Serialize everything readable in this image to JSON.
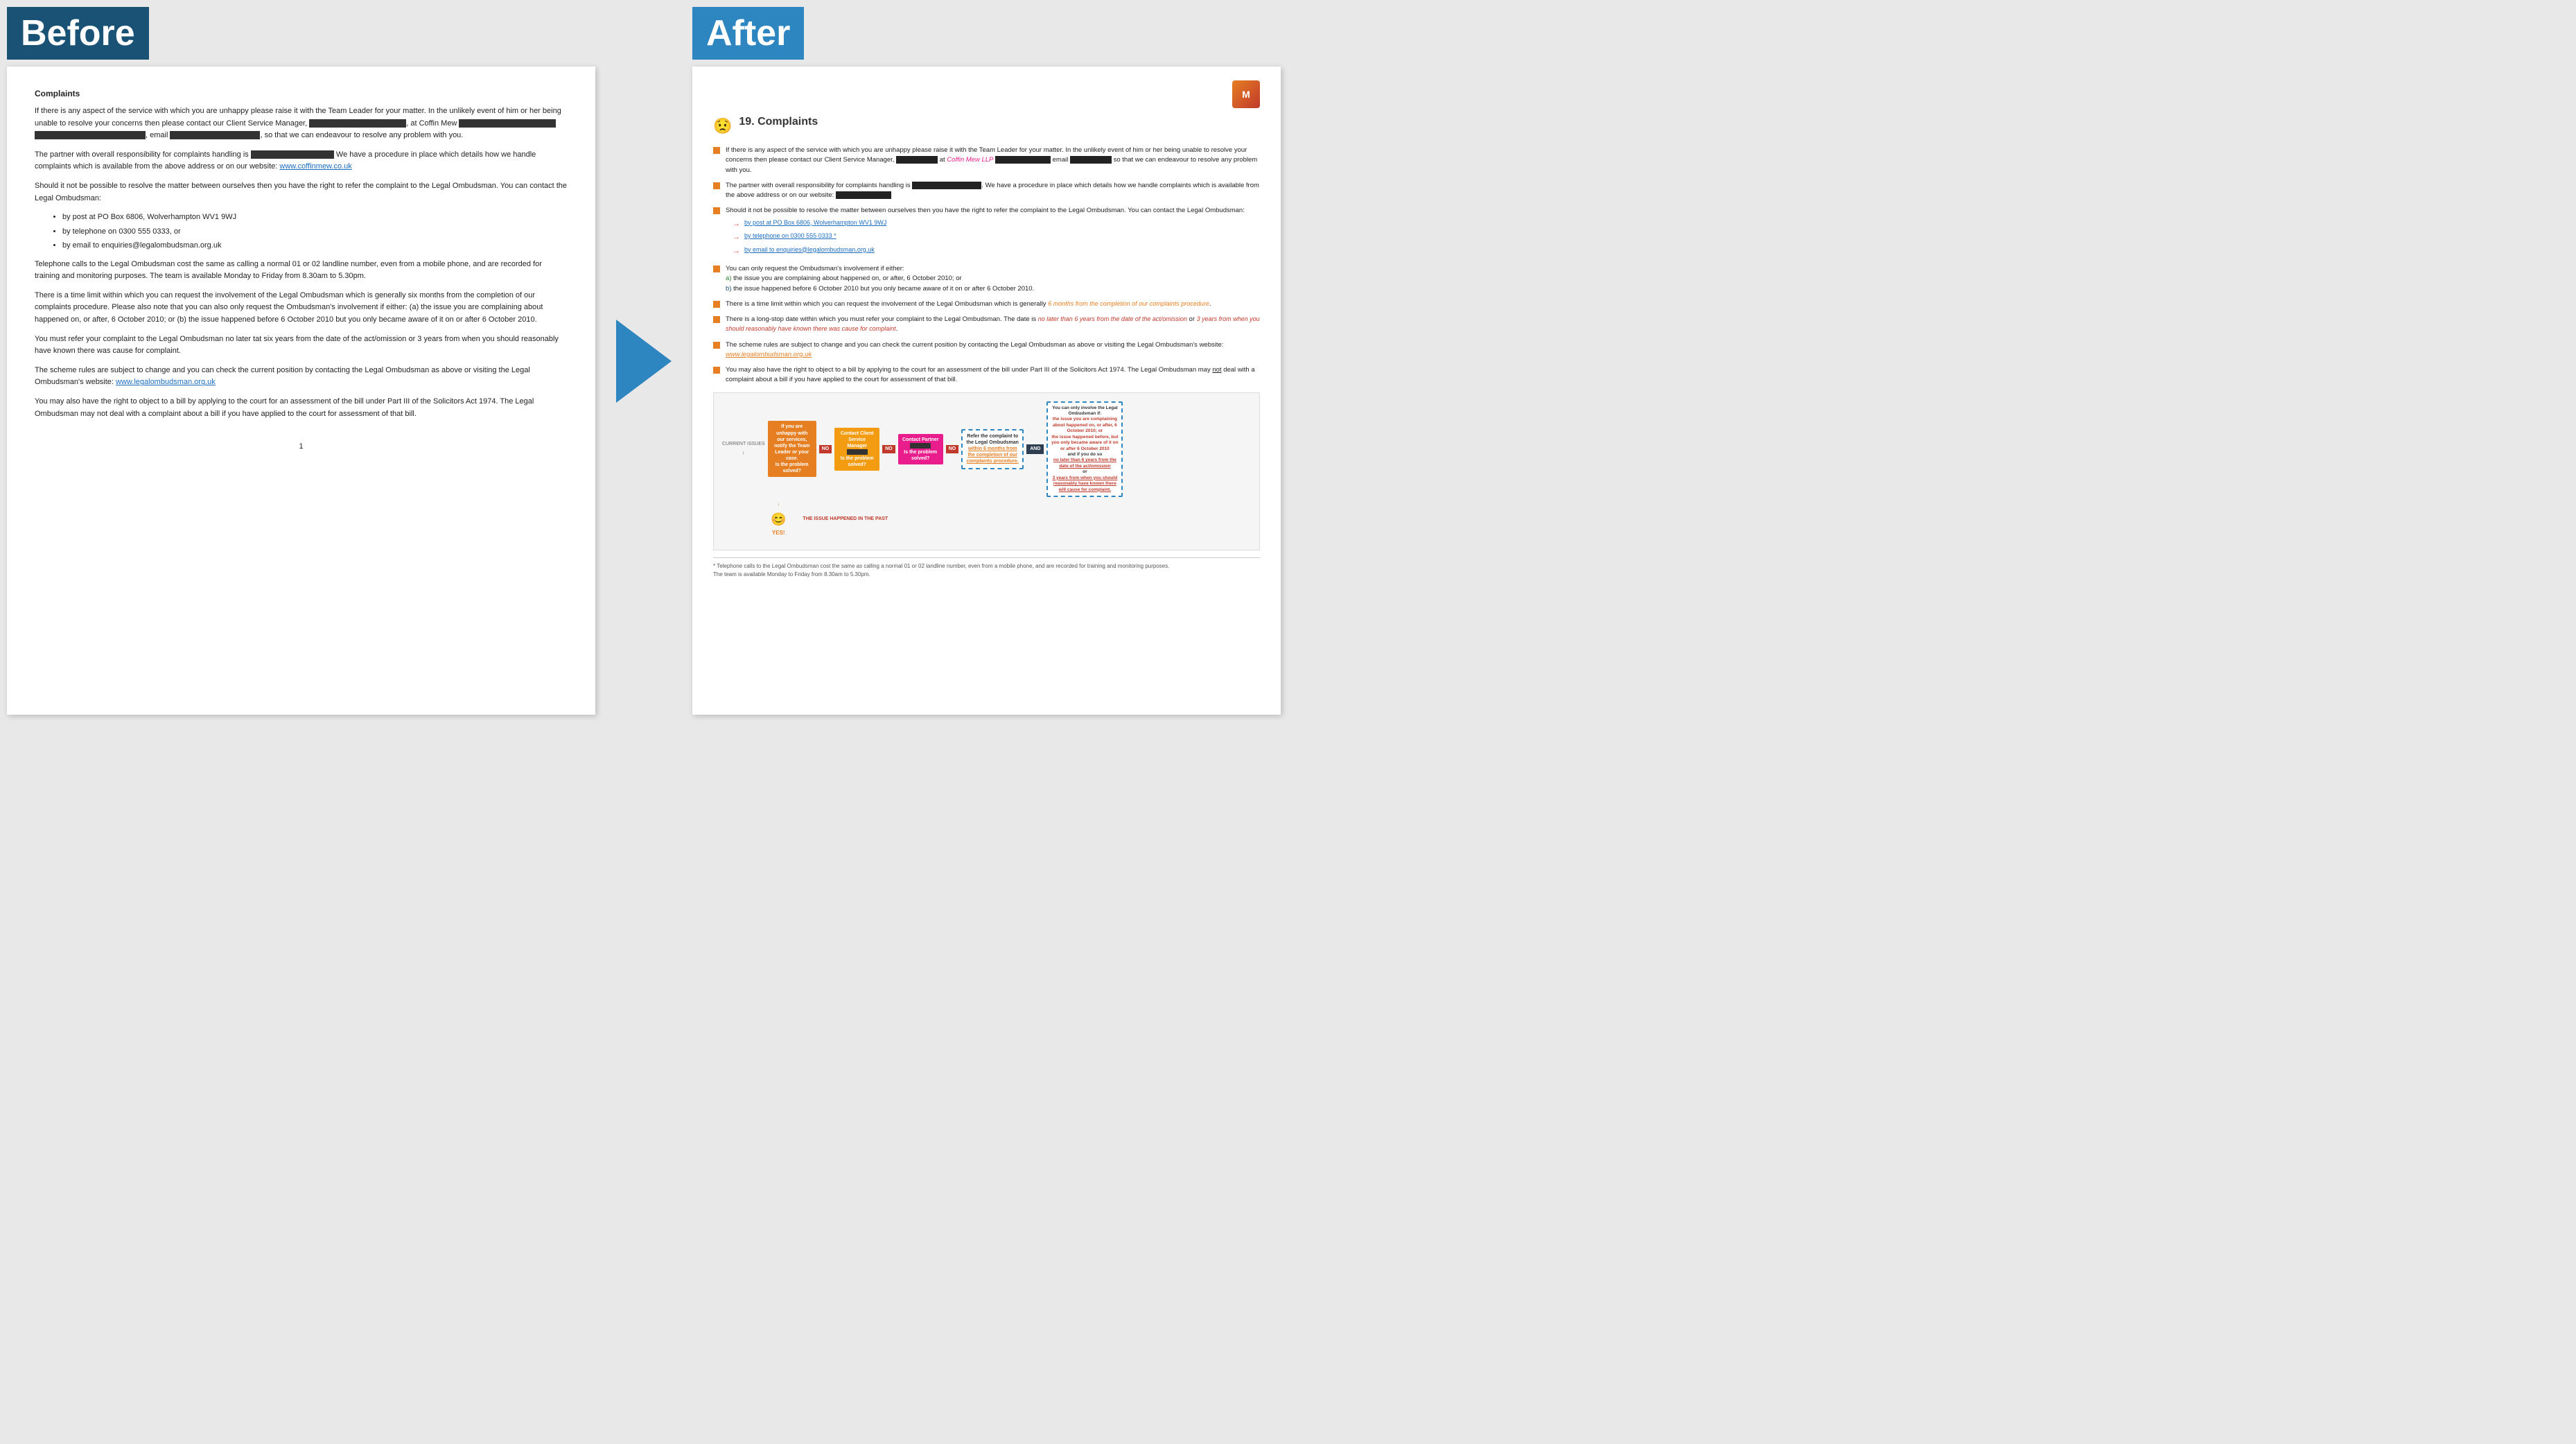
{
  "before": {
    "title": "Before",
    "document": {
      "heading": "Complaints",
      "paragraphs": [
        "If there is any aspect of the service with which you are unhappy please raise it with the Team Leader for your matter. In the unlikely event of him or her being unable to resolve your concerns then please contact our Client Service Manager,",
        "The partner with overall responsibility for complaints handling is",
        "We have a procedure in place which details how we handle complaints which is available from the above address or on our website:",
        "Should it not be possible to resolve the matter between ourselves then you have the right to refer the complaint to the Legal Ombudsman. You can contact the Legal Ombudsman:",
        "Telephone calls to the Legal Ombudsman cost the same as calling a normal 01 or 02 landline number, even from a mobile phone, and are recorded for training and monitoring purposes. The team is available Monday to Friday from 8.30am to 5.30pm.",
        "There is a time limit within which you can request the involvement of the Legal Ombudsman which is generally six months from the completion of our complaints procedure. Please also note that you can also only request the Ombudsman's involvement if either: (a) the issue you are complaining about happened on, or after, 6 October 2010; or (b) the issue happened before 6 October 2010 but you only became aware of it on or after 6 October 2010.",
        "You must refer your complaint to the Legal Ombudsman no later tat six years from the date of the act/omission or 3 years from when you should reasonably have known there was cause for complaint.",
        "The scheme rules are subject to change and you can check the current position by contacting the Legal Ombudsman as above or visiting the Legal Ombudsman's website:",
        "You may also have the right to object to a bill by applying to the court for an assessment of the bill under Part III of the Solicitors Act 1974. The Legal Ombudsman may not deal with a complaint about a bill if you have applied to the court for assessment of that bill."
      ],
      "bullets": [
        "by post at PO Box 6806, Wolverhampton WV1 9WJ",
        "by telephone on 0300 555 0333, or",
        "by email to enquiries@legalombudsman.org.uk"
      ],
      "website_link": "www.coffinmew.co.uk",
      "lgo_link": "www.legalombudsman.org.uk",
      "email_intro": "email",
      "so_that": ", so that we can endeavour to resolve any problem with you.",
      "page_number": "1"
    }
  },
  "after": {
    "title": "After",
    "logo": "M",
    "document": {
      "section_number": "19. Complaints",
      "bullets": [
        {
          "text_parts": [
            "If there is any aspect of the service with which you are unhappy please raise it with the Team Leader for your matter. In the unlikely event of him or her being unable to resolve your concerns then please contact our Client Service Manager,",
            "[REDACTED]",
            "at",
            "Coffin Mew LLP",
            "[REDACTED]",
            "email",
            "[REDACTED]",
            "so that we can endeavour to resolve any problem with you."
          ]
        },
        {
          "text_parts": [
            "The partner with overall responsibility for complaints handling is",
            "[REDACTED]",
            ". We have a procedure in place which details how we handle complaints which is available from the above address or on our website:",
            "[REDACTED]"
          ]
        },
        {
          "text_parts": [
            "Should it not be possible to resolve the matter between ourselves then you have the right to refer the complaint to the Legal Ombudsman. You can contact the Legal Ombudsman:"
          ]
        },
        {
          "sub_bullets": [
            "by post at PO Box 6806, Wolverhampton WV1 9WJ",
            "by telephone on 0300 555 0333 *",
            "by email to enquiries@legalombudsman.org.uk"
          ]
        },
        {
          "text_parts": [
            "You can only request the Ombudsman's involvement if either:",
            "a) the issue you are complaining about happened on, or after, 6 October 2010; or",
            "b) the issue happened before 6 October 2010 but you only became aware of it on or after 6 October 2010."
          ]
        },
        {
          "text_parts": [
            "There is a time limit within which you can request the involvement of the Legal Ombudsman which is generally",
            "6 months from the completion of our complaints procedure",
            "."
          ]
        },
        {
          "text_parts": [
            "There is a long-stop date within which you must refer your complaint to the Legal Ombudsman. The date is",
            "no later than 6 years from the date of the act/omission",
            "or",
            "3 years from when you should reasonably have known there was cause for complaint",
            "."
          ]
        },
        {
          "text_parts": [
            "The scheme rules are subject to change and you can check the current position by contacting the Legal Ombudsman as above or visiting the Legal Ombudsman's website:",
            "www.legalombudsman.org.uk"
          ]
        },
        {
          "text_parts": [
            "You may also have the right to object to a bill by applying to the court for an assessment of the bill under Part III of the Solicitors Act 1974. The Legal Ombudsman may",
            "not",
            "deal with a complaint about a bill if you have applied to the court for assessment of that bill."
          ]
        }
      ],
      "flowchart": {
        "current_issues_label": "CURRENT ISSUES",
        "past_label": "THE ISSUE HAPPENED IN THE PAST",
        "yes_label": "YES!",
        "and_label": "AND",
        "no_label": "NO",
        "box1": "If you are unhappy with our services, notify the Team Leader or your case. Is the problem solved?",
        "box2": "Contact Client Service Manager [REDACTED] Is the problem solved?",
        "box3": "Contact Partner [REDACTED] Is the problem solved?",
        "box4": "Refer the complaint to the Legal Ombudsman within 6 months from the completion of our complaints procedure.",
        "box5": "You can only involve the Legal Ombudsman if: the issue you are complaining about happened on, or after, 6 October 2010; or the issue happened before, but you only became aware of it on or after 6 October 2010 and if you do so no later than 6 years from the date of the act/omission or 3 years from when you should reasonably have known there will cause for complaint."
      },
      "footnote": "* Telephone calls to the Legal Ombudsman cost the same as calling a normal 01 or 02 landline number, even from a mobile phone, and are recorded for training and monitoring purposes.\nThe team is available Monday to Friday from 8.30am to 5.30pm."
    }
  },
  "colors": {
    "before_bg": "#1a5276",
    "after_bg": "#2e86c1",
    "arrow_color": "#2e86c1",
    "orange": "#e67e22",
    "pink": "#e91e8c",
    "red": "#c0392b"
  }
}
